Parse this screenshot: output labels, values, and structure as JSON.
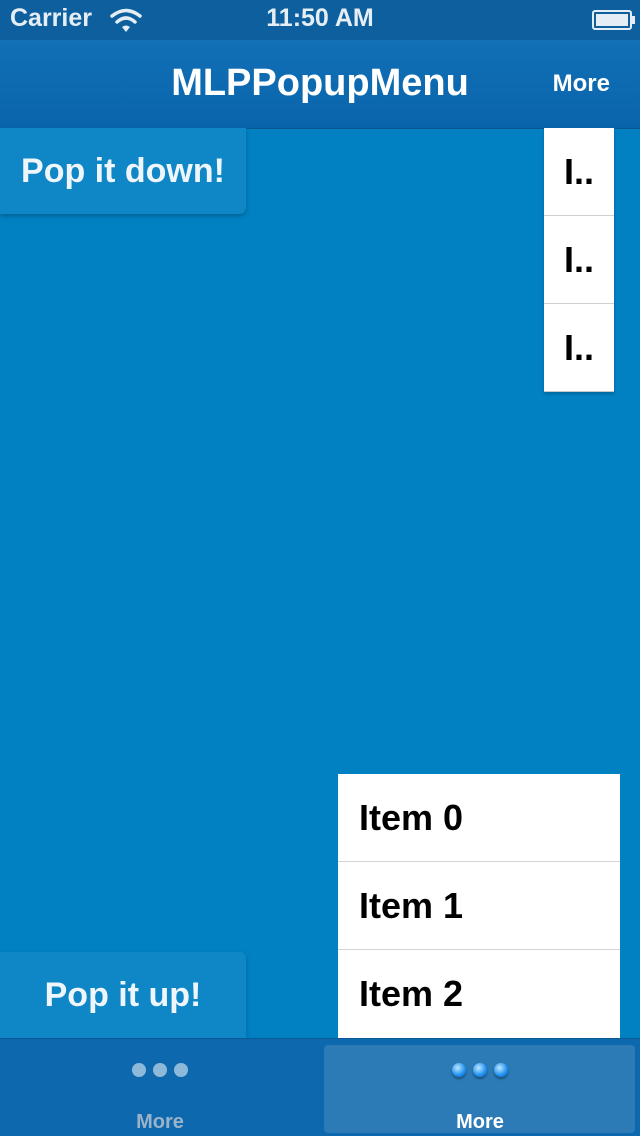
{
  "status_bar": {
    "carrier": "Carrier",
    "time": "11:50 AM",
    "wifi_icon": "wifi-icon",
    "battery_icon": "battery-icon"
  },
  "nav_bar": {
    "title": "MLPPopupMenu",
    "right_button": "More"
  },
  "buttons": {
    "pop_down": "Pop it down!",
    "pop_up": "Pop it up!"
  },
  "popup_top": {
    "items": [
      "I..",
      "I..",
      "I.."
    ]
  },
  "popup_bottom": {
    "items": [
      "Item 0",
      "Item 1",
      "Item 2"
    ]
  },
  "tab_bar": {
    "tabs": [
      {
        "label": "More",
        "icon": "more-dots-icon",
        "selected": false
      },
      {
        "label": "More",
        "icon": "more-dots-icon",
        "selected": true
      }
    ]
  },
  "colors": {
    "background": "#0181c2",
    "nav_bar": "#0d64aa",
    "menu_background": "#ffffff"
  }
}
